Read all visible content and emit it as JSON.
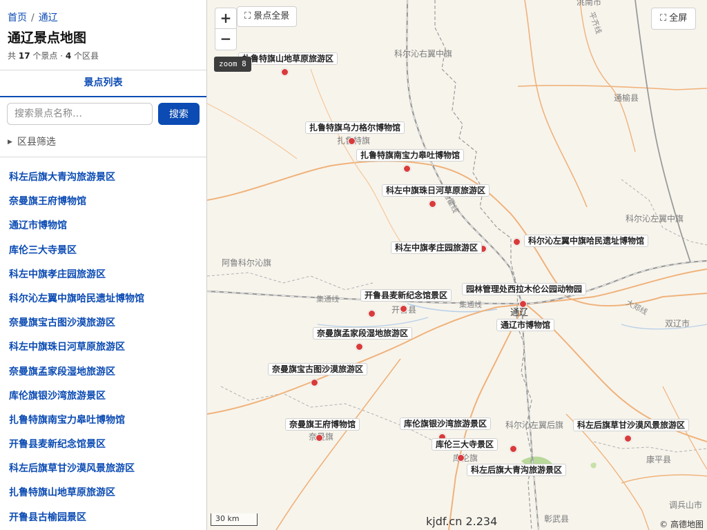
{
  "breadcrumb": {
    "home": "首页",
    "separator": "/",
    "current": "通辽"
  },
  "page_title": "通辽景点地图",
  "stats": {
    "prefix": "共",
    "spots": "17",
    "spots_unit": "个景点 ·",
    "districts": "4",
    "districts_unit": "个区县"
  },
  "tab": "景点列表",
  "search": {
    "placeholder": "搜索景点名称…",
    "button": "搜索"
  },
  "filter": {
    "label": "区县筛选"
  },
  "spot_list": [
    "科左后旗大青沟旅游景区",
    "奈曼旗王府博物馆",
    "通辽市博物馆",
    "库伦三大寺景区",
    "科左中旗孝庄园旅游区",
    "科尔沁左翼中旗哈民遗址博物馆",
    "奈曼旗宝古图沙漠旅游区",
    "科左中旗珠日河草原旅游区",
    "奈曼旗孟家段湿地旅游区",
    "库伦旗银沙湾旅游景区",
    "扎鲁特旗南宝力皋吐博物馆",
    "开鲁县麦新纪念馆景区",
    "科左后旗草甘沙漠风景旅游区",
    "扎鲁特旗山地草原旅游区",
    "开鲁县古榆园景区"
  ],
  "map": {
    "zoom_in": "+",
    "zoom_out": "−",
    "zoom_level": "zoom 8",
    "overview_button": "⛶ 景点全景",
    "fullscreen_button": "⛶ 全屏",
    "scale": "30 km",
    "version": "kjdf.cn 2.234",
    "attribution": "© 高德地图",
    "places": [
      "洮南市",
      "科尔沁右翼中旗",
      "通榆县",
      "扎鲁特旗",
      "科尔沁左翼中旗",
      "阿鲁科尔沁旗",
      "开鲁县",
      "通辽",
      "双辽市",
      "奈曼旗",
      "库伦旗",
      "科尔沁左翼后旗",
      "康平县",
      "彰武县",
      "调兵山市"
    ],
    "rail_labels": [
      "集通线",
      "集通线",
      "大郑线",
      "通霍线",
      "平齐线"
    ],
    "poi_labels": [
      "扎鲁特旗山地草原旅游区",
      "扎鲁特旗乌力格尔博物馆",
      "扎鲁特旗南宝力皋吐博物馆",
      "科左中旗珠日河草原旅游区",
      "科左中旗孝庄园旅游区",
      "科尔沁左翼中旗哈民遗址博物馆",
      "园林管理处西拉木伦公园动物园",
      "开鲁县麦新纪念馆景区",
      "通辽市博物馆",
      "奈曼旗孟家段湿地旅游区",
      "奈曼旗宝古图沙漠旅游区",
      "奈曼旗王府博物馆",
      "库伦旗银沙湾旅游景区",
      "库伦三大寺景区",
      "科左后旗大青沟旅游景区",
      "科左后旗草甘沙漠风景旅游区"
    ],
    "colors": {
      "marker": "#d93b3b",
      "road": "#f0b27a",
      "rail": "#9a9a9a",
      "water": "#a8c8e8",
      "forest": "#b8d99a",
      "accent": "#0b4bb3"
    }
  }
}
